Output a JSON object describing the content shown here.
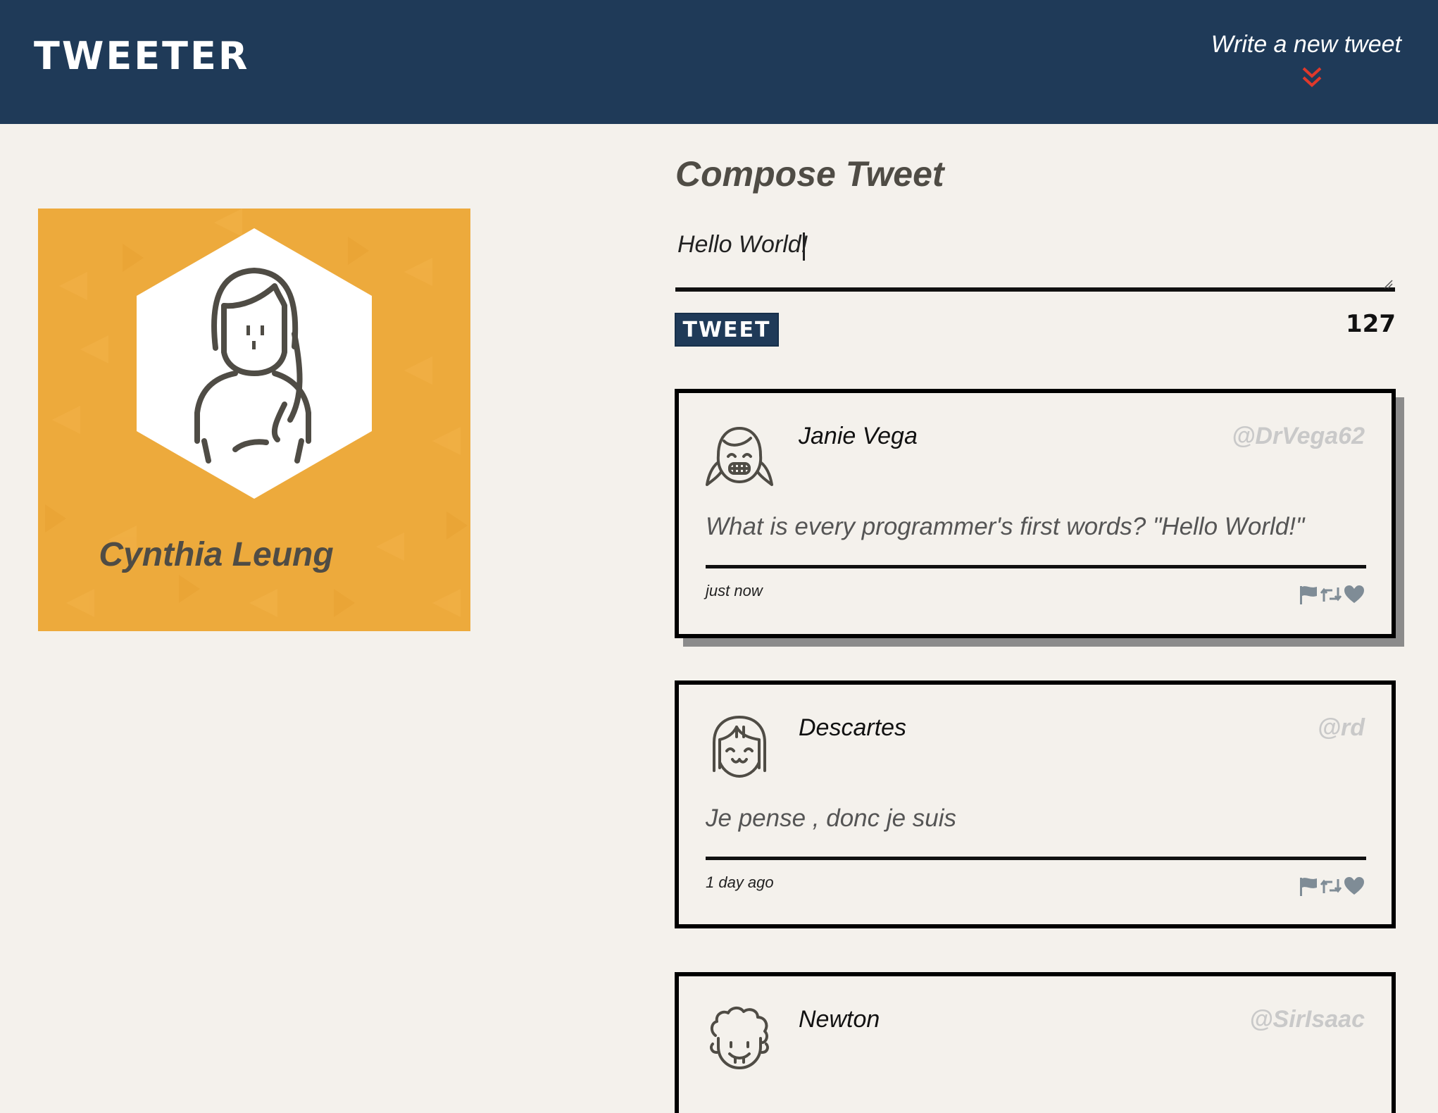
{
  "header": {
    "brand": "TWEETER",
    "write_link": "Write a new tweet",
    "chevron_icon": "double-chevron-down-icon",
    "chevron_color": "#e0392b",
    "background_color": "#1f3a58"
  },
  "profile": {
    "name": "Cynthia Leung",
    "avatar_icon": "woman-avatar-icon",
    "background_color": "#edaa3c"
  },
  "compose": {
    "title": "Compose Tweet",
    "text_value": "Hello World!",
    "button_label": "TWEET",
    "counter": "127"
  },
  "tweets": [
    {
      "name": "Janie Vega",
      "handle": "@DrVega62",
      "body": "What is every programmer's first words? \"Hello World!\"",
      "time": "just now",
      "avatar_icon": "girl-smiling-avatar-icon"
    },
    {
      "name": "Descartes",
      "handle": "@rd",
      "body": "Je pense , donc je suis",
      "time": "1 day ago",
      "avatar_icon": "bob-haircut-avatar-icon"
    },
    {
      "name": "Newton",
      "handle": "@SirIsaac",
      "avatar_icon": "curly-hair-avatar-icon"
    }
  ],
  "action_icons": [
    "flag-icon",
    "retweet-icon",
    "heart-icon"
  ],
  "action_icon_color": "#7f8c96"
}
